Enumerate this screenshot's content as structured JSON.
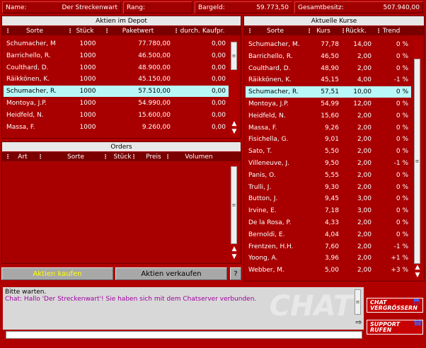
{
  "info": {
    "name_label": "Name:",
    "name_value": "Der Streckenwart",
    "rank_label": "Rang:",
    "cash_label": "Bargeld:",
    "cash_value": "59.773,50",
    "total_label": "Gesamtbesitz:",
    "total_value": "507.940,00"
  },
  "depot": {
    "title": "Aktien im Depot",
    "headers": [
      "Sorte",
      "Stück",
      "Paketwert",
      "durch. Kaufpr."
    ],
    "rows": [
      [
        "Schumacher, M",
        "1000",
        "77.780,00",
        "0,00"
      ],
      [
        "Barrichello, R.",
        "1000",
        "46.500,00",
        "0,00"
      ],
      [
        "Coulthard, D.",
        "1000",
        "48.900,00",
        "0,00"
      ],
      [
        "Räikkönen, K.",
        "1000",
        "45.150,00",
        "0,00"
      ],
      [
        "Schumacher, R.",
        "1000",
        "57.510,00",
        "0,00"
      ],
      [
        "Montoya, J.P.",
        "1000",
        "54.990,00",
        "0,00"
      ],
      [
        "Heidfeld, N.",
        "1000",
        "15.600,00",
        "0,00"
      ],
      [
        "Massa, F.",
        "1000",
        "9.260,00",
        "0,00"
      ]
    ],
    "selected_index": 4
  },
  "orders": {
    "title": "Orders",
    "headers": [
      "Art",
      "Sorte",
      "Stück",
      "Preis",
      "Volumen"
    ]
  },
  "buttons": {
    "buy": "Aktien kaufen",
    "sell": "Aktien verkaufen",
    "help": "?"
  },
  "kurse": {
    "title": "Aktuelle Kurse",
    "headers": [
      "Sorte",
      "Kurs",
      "Rückk.",
      "Trend"
    ],
    "rows": [
      [
        "Schumacher, M.",
        "77,78",
        "14,00",
        "0 %"
      ],
      [
        "Barrichello, R.",
        "46,50",
        "2,00",
        "0 %"
      ],
      [
        "Coulthard, D.",
        "48,90",
        "2,00",
        "0 %"
      ],
      [
        "Räikkönen, K.",
        "45,15",
        "4,00",
        "-1 %"
      ],
      [
        "Schumacher, R.",
        "57,51",
        "10,00",
        "0 %"
      ],
      [
        "Montoya, J.P.",
        "54,99",
        "12,00",
        "0 %"
      ],
      [
        "Heidfeld, N.",
        "15,60",
        "2,00",
        "0 %"
      ],
      [
        "Massa, F.",
        "9,26",
        "2,00",
        "0 %"
      ],
      [
        "Fisichella, G.",
        "9,01",
        "2,00",
        "0 %"
      ],
      [
        "Sato, T.",
        "5,50",
        "2,00",
        "0 %"
      ],
      [
        "Villeneuve, J.",
        "9,50",
        "2,00",
        "-1 %"
      ],
      [
        "Panis, O.",
        "5,55",
        "2,00",
        "0 %"
      ],
      [
        "Trulli, J.",
        "9,30",
        "2,00",
        "0 %"
      ],
      [
        "Button, J.",
        "9,45",
        "3,00",
        "0 %"
      ],
      [
        "Irvine, E.",
        "7,18",
        "3,00",
        "0 %"
      ],
      [
        "De la Rosa, P.",
        "4,33",
        "2,00",
        "0 %"
      ],
      [
        "Bernoldi, E.",
        "4,04",
        "2,00",
        "0 %"
      ],
      [
        "Frentzen, H.H.",
        "7,60",
        "2,00",
        "-1 %"
      ],
      [
        "Yoong, A.",
        "3,96",
        "2,00",
        "+1 %"
      ],
      [
        "Webber, M.",
        "5,00",
        "2,00",
        "+3 %"
      ]
    ],
    "selected_index": 4
  },
  "chat": {
    "line1": "Bitte warten.",
    "line2": "Chat: Hallo 'Der Streckenwart'! Sie haben sich mit dem Chatserver verbunden.",
    "watermark": "CHAT",
    "enlarge_label_1": "CHAT",
    "enlarge_label_2": "VERGRÖSSERN",
    "support_label_1": "SUPPORT",
    "support_label_2": "RUFEN"
  },
  "colors": {
    "background": "#b00000",
    "selected_row": "#b8f8f8",
    "buy_text": "#ffff00",
    "chat_purple": "#a000a0"
  }
}
